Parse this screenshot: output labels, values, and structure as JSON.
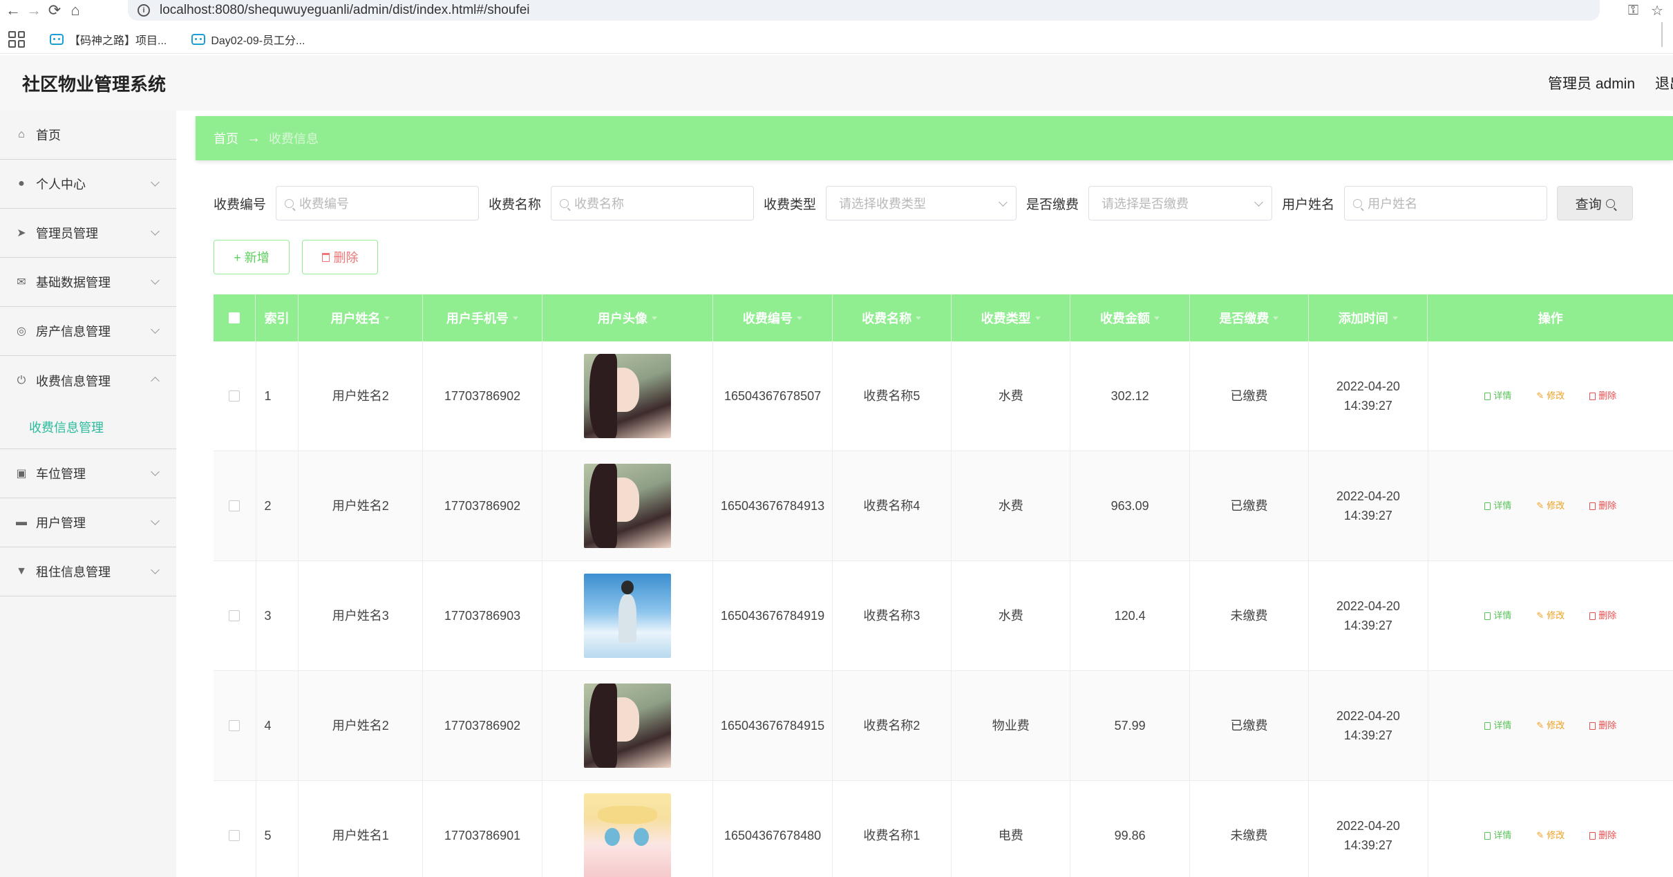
{
  "browser": {
    "url": "localhost:8080/shequwuyeguanli/admin/dist/index.html#/shoufei",
    "bookmarks": [
      {
        "label": "【码神之路】项目..."
      },
      {
        "label": "Day02-09-员工分..."
      }
    ]
  },
  "header": {
    "app_title": "社区物业管理系统",
    "admin_label": "管理员 admin",
    "logout_label": "退出"
  },
  "sidebar": {
    "items": [
      {
        "label": "首页",
        "icon": "home-icon"
      },
      {
        "label": "个人中心",
        "icon": "user-icon"
      },
      {
        "label": "管理员管理",
        "icon": "send-icon"
      },
      {
        "label": "基础数据管理",
        "icon": "mail-icon"
      },
      {
        "label": "房产信息管理",
        "icon": "compass-icon"
      },
      {
        "label": "收费信息管理",
        "icon": "power-icon"
      },
      {
        "label": "车位管理",
        "icon": "clipboard-icon"
      },
      {
        "label": "用户管理",
        "icon": "printer-icon"
      },
      {
        "label": "租住信息管理",
        "icon": "stamp-icon"
      }
    ],
    "active_sub": "收费信息管理"
  },
  "breadcrumb": {
    "home": "首页",
    "sep": "→",
    "current": "收费信息"
  },
  "filters": {
    "fee_no_label": "收费编号",
    "fee_no_placeholder": "收费编号",
    "fee_name_label": "收费名称",
    "fee_name_placeholder": "收费名称",
    "fee_type_label": "收费类型",
    "fee_type_placeholder": "请选择收费类型",
    "paid_label": "是否缴费",
    "paid_placeholder": "请选择是否缴费",
    "user_name_label": "用户姓名",
    "user_name_placeholder": "用户姓名",
    "query_label": "查询"
  },
  "actions": {
    "add_label": "+ 新增",
    "delete_label": "删除"
  },
  "table": {
    "columns": [
      "索引",
      "用户姓名",
      "用户手机号",
      "用户头像",
      "收费编号",
      "收费名称",
      "收费类型",
      "收费金额",
      "是否缴费",
      "添加时间",
      "操作"
    ],
    "op_labels": {
      "detail": "详情",
      "edit": "修改",
      "remove": "删除"
    },
    "rows": [
      {
        "index": "1",
        "user_name": "用户姓名2",
        "phone": "17703786902",
        "avatar": "girl",
        "fee_no": "16504367678507",
        "fee_name": "收费名称5",
        "fee_type": "水费",
        "amount": "302.12",
        "paid": "已缴费",
        "time": "2022-04-20 14:39:27"
      },
      {
        "index": "2",
        "user_name": "用户姓名2",
        "phone": "17703786902",
        "avatar": "girl",
        "fee_no": "165043676784913",
        "fee_name": "收费名称4",
        "fee_type": "水费",
        "amount": "963.09",
        "paid": "已缴费",
        "time": "2022-04-20 14:39:27"
      },
      {
        "index": "3",
        "user_name": "用户姓名3",
        "phone": "17703786903",
        "avatar": "boy",
        "fee_no": "165043676784919",
        "fee_name": "收费名称3",
        "fee_type": "水费",
        "amount": "120.4",
        "paid": "未缴费",
        "time": "2022-04-20 14:39:27"
      },
      {
        "index": "4",
        "user_name": "用户姓名2",
        "phone": "17703786902",
        "avatar": "girl",
        "fee_no": "165043676784915",
        "fee_name": "收费名称2",
        "fee_type": "物业费",
        "amount": "57.99",
        "paid": "已缴费",
        "time": "2022-04-20 14:39:27"
      },
      {
        "index": "5",
        "user_name": "用户姓名1",
        "phone": "17703786901",
        "avatar": "anime",
        "fee_no": "16504367678480",
        "fee_name": "收费名称1",
        "fee_type": "电费",
        "amount": "99.86",
        "paid": "未缴费",
        "time": "2022-04-20 14:39:27"
      }
    ]
  },
  "colors": {
    "accent_green": "#90ee90",
    "active_teal": "#2bbb9c",
    "detail": "#58c258",
    "edit": "#f0a020",
    "remove": "#e84c4c"
  }
}
